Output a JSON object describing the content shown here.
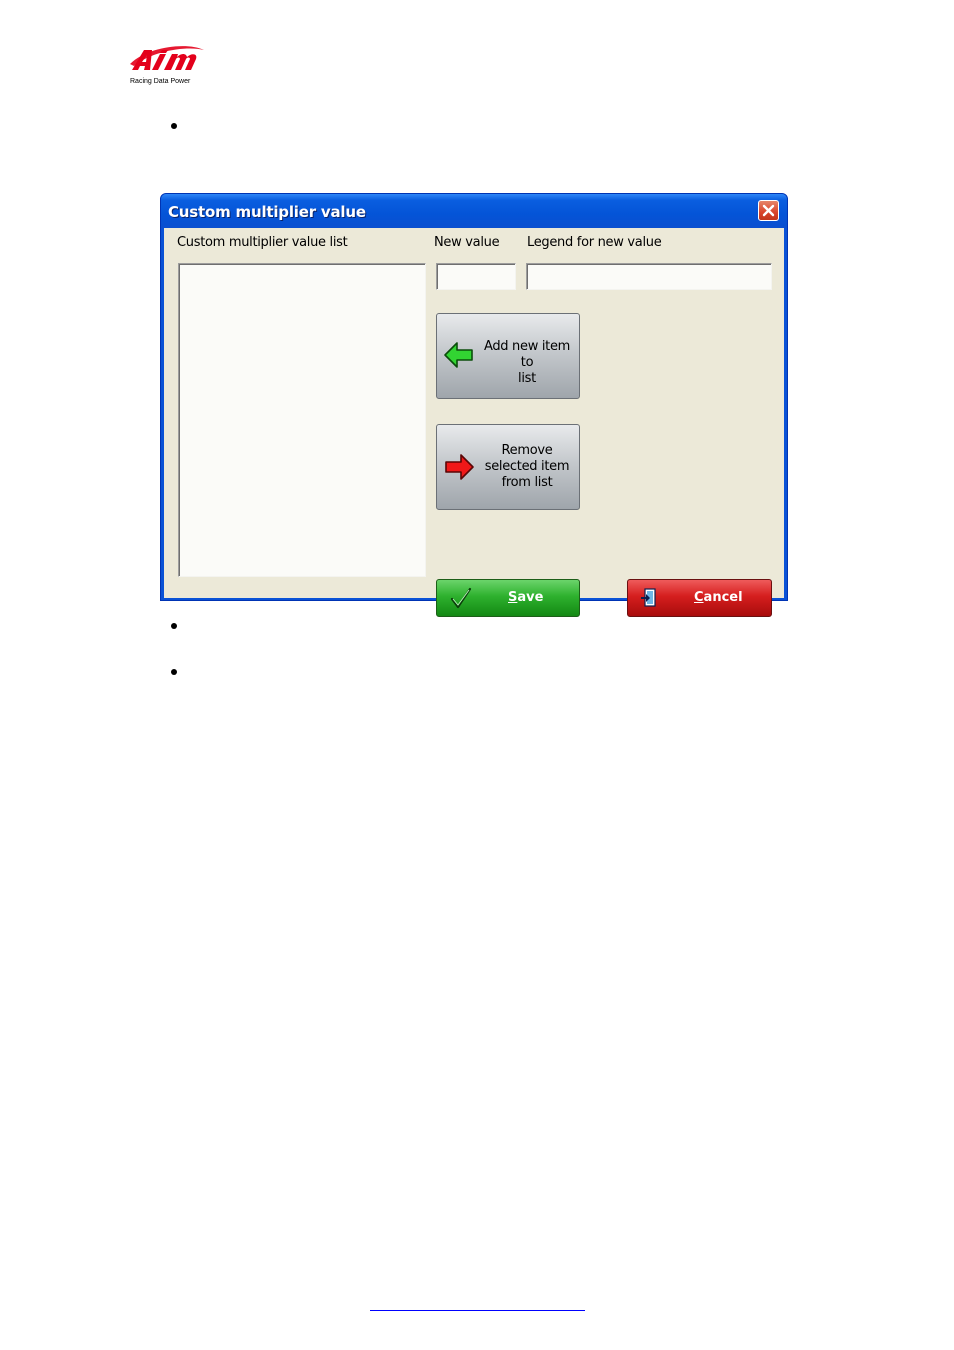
{
  "page": {
    "logo_name": "AiM",
    "logo_tagline": "Racing Data Power",
    "footer_link_text": ""
  },
  "dialog": {
    "title": "Custom multiplier value",
    "close_icon": "close-icon",
    "list_label": "Custom multiplier value list",
    "list_items": [],
    "new_value_label": "New value",
    "new_value": "",
    "legend_label": "Legend for new value",
    "legend_value": "",
    "add_button": {
      "label": "Add new item to list",
      "line1": "Add new item to",
      "line2": "list",
      "icon": "green-left-arrow-icon"
    },
    "remove_button": {
      "label": "Remove selected item from list",
      "line1": "Remove",
      "line2": "selected item",
      "line3": "from list",
      "icon": "red-right-arrow-icon"
    },
    "save_button": {
      "label": "Save",
      "mnemonic": "S",
      "rest": "ave",
      "icon": "checkmark-icon"
    },
    "cancel_button": {
      "label": "Cancel",
      "mnemonic": "C",
      "rest": "ancel",
      "icon": "exit-door-icon"
    }
  },
  "colors": {
    "title_bar": "#0a5ee0",
    "dialog_body": "#ece9d8",
    "save_green": "#2eb12e",
    "cancel_red": "#d51e1e"
  }
}
